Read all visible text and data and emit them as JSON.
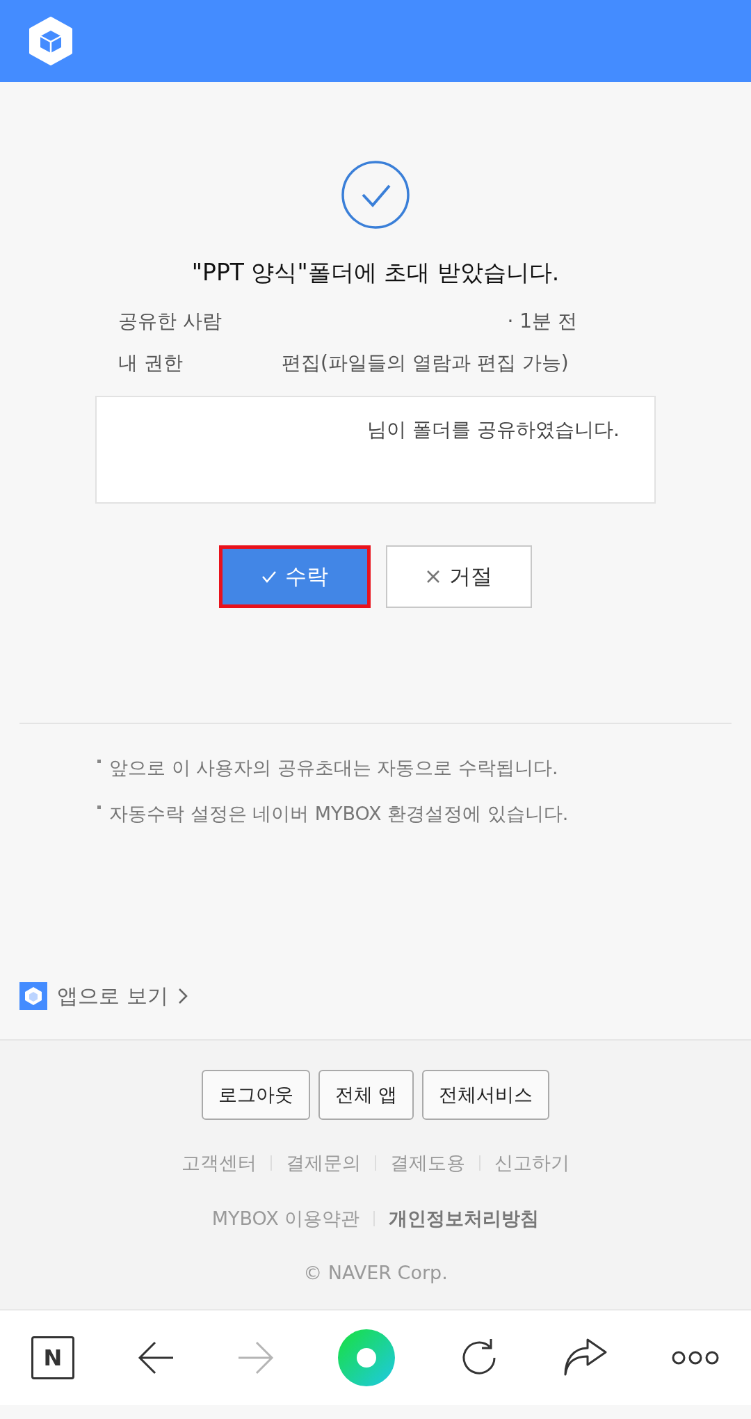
{
  "invite": {
    "title": "\"PPT 양식\"폴더에 초대 받았습니다.",
    "rows": [
      {
        "label": "공유한 사람",
        "value": "· 1분 전"
      },
      {
        "label": "내 권한",
        "value": "편집(파일들의 열람과 편집 가능)"
      }
    ],
    "message": "님이 폴더를 공유하였습니다.",
    "buttons": [
      {
        "kind": "accept",
        "label": "수락",
        "highlighted": true
      },
      {
        "kind": "reject",
        "label": "거절",
        "highlighted": false
      }
    ]
  },
  "notes": [
    "앞으로 이 사용자의 공유초대는 자동으로 수락됩니다.",
    "자동수락 설정은 네이버 MYBOX 환경설정에 있습니다."
  ],
  "app_link": "앱으로 보기",
  "footer": {
    "buttons": [
      "로그아웃",
      "전체 앱",
      "전체서비스"
    ],
    "links": [
      {
        "label": "고객센터",
        "bold": false
      },
      {
        "label": "결제문의",
        "bold": false
      },
      {
        "label": "결제도용",
        "bold": false
      },
      {
        "label": "신고하기",
        "bold": false
      }
    ],
    "legal": [
      {
        "label": "MYBOX 이용약관",
        "bold": false
      },
      {
        "label": "개인정보처리방침",
        "bold": true
      }
    ],
    "copyright": "© NAVER Corp."
  },
  "bottom_nav": [
    {
      "kind": "home",
      "label": "N",
      "disabled": false
    },
    {
      "kind": "back",
      "disabled": false
    },
    {
      "kind": "forward",
      "disabled": true
    },
    {
      "kind": "green",
      "disabled": false
    },
    {
      "kind": "reload",
      "disabled": false
    },
    {
      "kind": "share",
      "disabled": false
    },
    {
      "kind": "more",
      "disabled": false
    }
  ]
}
